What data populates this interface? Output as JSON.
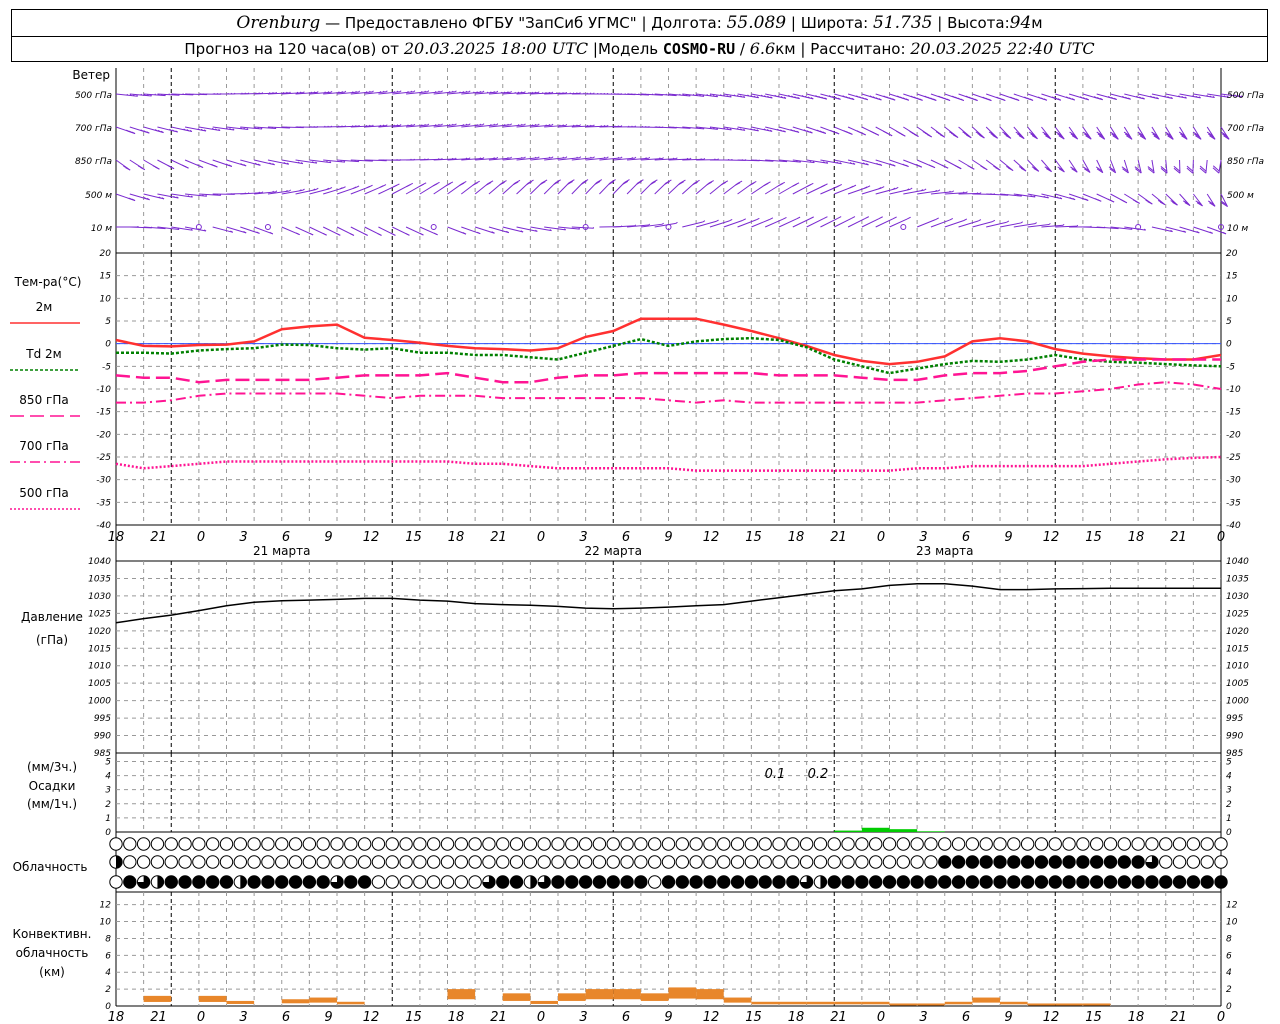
{
  "header": {
    "city": "Orenburg",
    "provider": "— Предоставлено ФГБУ \"ЗапСиб УГМС\"",
    "lon_label": "Долгота:",
    "lon": "55.089",
    "lat_label": "Широта:",
    "lat": "51.735",
    "alt_label": "Высота:",
    "alt": "94",
    "alt_unit": "м",
    "forecast_text": "Прогноз на 120 часа(ов) от",
    "forecast_start": "20.03.2025 18:00 UTC",
    "model_label": "Модель",
    "model": "COSMO-RU",
    "resolution": "6.6",
    "res_unit": "км",
    "calc_label": "Рассчитано:",
    "calc_time": "20.03.2025 22:40 UTC",
    "sep": "|"
  },
  "wind": {
    "title": "Ветер",
    "levels": [
      "500 гПа",
      "700 гПа",
      "850 гПа",
      "500 м",
      "10 м"
    ]
  },
  "temp_panel": {
    "title": "Тем-ра(°C)",
    "legend": [
      {
        "label": "2м",
        "color": "#ff3030",
        "dash": ""
      },
      {
        "label": "Td 2м",
        "color": "#008000",
        "dash": "3,2"
      },
      {
        "label": "850 гПа",
        "color": "#ff1493",
        "dash": "14,6"
      },
      {
        "label": "700 гПа",
        "color": "#ff1493",
        "dash": "10,4,2,4"
      },
      {
        "label": "500 гПа",
        "color": "#ff1493",
        "dash": "2,2"
      }
    ],
    "y_ticks": [
      "20",
      "15",
      "10",
      "5",
      "0",
      "-5",
      "-10",
      "-15",
      "-20",
      "-25",
      "-30",
      "-35",
      "-40"
    ]
  },
  "x_axis": {
    "hour_labels": [
      "18",
      "21",
      "0",
      "3",
      "6",
      "9",
      "12",
      "15",
      "18",
      "21",
      "0",
      "3",
      "6",
      "9",
      "12",
      "15",
      "18",
      "21",
      "0",
      "3",
      "6",
      "9",
      "12",
      "15",
      "18",
      "21",
      "0"
    ],
    "day_labels": [
      "21 марта",
      "22 марта",
      "23 марта"
    ]
  },
  "pressure_panel": {
    "title": "Давление",
    "unit": "(гПа)",
    "y_ticks": [
      "1040",
      "1035",
      "1030",
      "1025",
      "1020",
      "1015",
      "1010",
      "1005",
      "1000",
      "995",
      "990",
      "985"
    ]
  },
  "precip_panel": {
    "unit1": "(мм/3ч.)",
    "title": "Осадки",
    "unit2": "(мм/1ч.)",
    "y_ticks": [
      "5",
      "4",
      "3",
      "2",
      "1",
      "0"
    ],
    "annotations": [
      "0.1",
      "0.2"
    ]
  },
  "cloud_panel": {
    "title": "Облачность"
  },
  "conv_panel": {
    "title1": "Конвективн.",
    "title2": "облачность",
    "unit": "(км)",
    "y_ticks": [
      "12",
      "10",
      "8",
      "6",
      "4",
      "2",
      "0"
    ]
  },
  "chart_data": [
    {
      "type": "line",
      "title": "Тем-ра(°C)",
      "x": [
        0,
        3,
        6,
        9,
        12,
        15,
        18,
        21,
        24,
        27,
        30,
        33,
        36,
        39,
        42,
        45,
        48,
        51,
        54,
        57,
        60,
        63,
        66,
        69,
        72,
        75,
        78,
        81,
        84,
        87,
        90,
        93,
        96,
        99,
        102,
        105,
        108,
        111,
        114,
        117,
        120
      ],
      "ylim": [
        -40,
        20
      ],
      "series": [
        {
          "name": "2м",
          "color": "#ff3030",
          "values": [
            0.8,
            -0.5,
            -0.6,
            -0.3,
            -0.2,
            0.5,
            3.2,
            3.8,
            4.2,
            1.3,
            0.8,
            0.2,
            -0.5,
            -1.0,
            -1.2,
            -1.5,
            -1.0,
            1.5,
            2.8,
            5.5,
            5.5,
            5.5,
            4.2,
            2.8,
            1.2,
            -0.5,
            -2.5,
            -3.8,
            -4.5,
            -4.0,
            -2.8,
            0.5,
            1.2,
            0.5,
            -1.2,
            -2.2,
            -2.8,
            -3.2,
            -3.5,
            -3.5,
            -2.5
          ]
        },
        {
          "name": "Td 2м",
          "color": "#008000",
          "values": [
            -2.0,
            -2.0,
            -2.2,
            -1.5,
            -1.2,
            -1.0,
            -0.2,
            -0.3,
            -1.0,
            -1.3,
            -1.0,
            -2.0,
            -2.0,
            -2.5,
            -2.5,
            -3.0,
            -3.5,
            -2.0,
            -0.5,
            1.0,
            -0.5,
            0.5,
            1.0,
            1.2,
            0.8,
            -0.8,
            -3.5,
            -5.0,
            -6.5,
            -5.5,
            -4.5,
            -3.8,
            -4.0,
            -3.5,
            -2.5,
            -3.5,
            -4.0,
            -4.2,
            -4.5,
            -4.8,
            -5.0
          ]
        },
        {
          "name": "850 гПа",
          "color": "#ff1493",
          "values": [
            -7,
            -7.5,
            -7.5,
            -8.5,
            -8,
            -8,
            -8,
            -8,
            -7.5,
            -7,
            -7,
            -7,
            -6.5,
            -7.5,
            -8.5,
            -8.5,
            -7.5,
            -7,
            -7,
            -6.5,
            -6.5,
            -6.5,
            -6.5,
            -6.5,
            -7,
            -7,
            -7,
            -7.5,
            -8,
            -8,
            -7,
            -6.5,
            -6.5,
            -6,
            -5,
            -4,
            -3.5,
            -3.5,
            -3.5,
            -3.5,
            -3.5
          ]
        },
        {
          "name": "700 гПа",
          "color": "#ff1493",
          "values": [
            -13,
            -13,
            -12.5,
            -11.5,
            -11,
            -11,
            -11,
            -11,
            -11,
            -11.5,
            -12,
            -11.5,
            -11.5,
            -11.5,
            -12,
            -12,
            -12,
            -12,
            -12,
            -12,
            -12.5,
            -13,
            -12.5,
            -13,
            -13,
            -13,
            -13,
            -13,
            -13,
            -13,
            -12.5,
            -12,
            -11.5,
            -11,
            -11,
            -10.5,
            -10,
            -9,
            -8.5,
            -9,
            -10
          ]
        },
        {
          "name": "500 гПа",
          "color": "#ff1493",
          "values": [
            -26.5,
            -27.5,
            -27,
            -26.5,
            -26,
            -26,
            -26,
            -26,
            -26,
            -26,
            -26,
            -26,
            -26,
            -26.5,
            -26.5,
            -27,
            -27.5,
            -27.5,
            -27.5,
            -27.5,
            -27.5,
            -28,
            -28,
            -28,
            -28,
            -28,
            -28,
            -28,
            -28,
            -27.5,
            -27.5,
            -27,
            -27,
            -27,
            -27,
            -27,
            -26.5,
            -26,
            -25.5,
            -25.2,
            -25
          ]
        }
      ]
    },
    {
      "type": "line",
      "title": "Давление",
      "x": [
        0,
        3,
        6,
        9,
        12,
        15,
        18,
        21,
        24,
        27,
        30,
        33,
        36,
        39,
        42,
        45,
        48,
        51,
        54,
        57,
        60,
        63,
        66,
        69,
        72,
        75,
        78,
        81,
        84,
        87,
        90,
        93,
        96,
        99,
        102,
        105,
        108,
        111,
        114,
        117,
        120
      ],
      "ylim": [
        985,
        1040
      ],
      "series": [
        {
          "name": "Давление",
          "color": "#000000",
          "values": [
            1022.3,
            1023.5,
            1024.5,
            1025.8,
            1027.2,
            1028.2,
            1028.6,
            1028.8,
            1029,
            1029.3,
            1029.3,
            1028.8,
            1028.5,
            1027.8,
            1027.5,
            1027.3,
            1027,
            1026.5,
            1026.3,
            1026.5,
            1026.8,
            1027.2,
            1027.5,
            1028.5,
            1029.5,
            1030.5,
            1031.5,
            1032,
            1033,
            1033.5,
            1033.5,
            1032.8,
            1031.8,
            1031.8,
            1032,
            1032.1,
            1032.2,
            1032.2,
            1032.2,
            1032.2,
            1032.2
          ]
        }
      ]
    },
    {
      "type": "bar",
      "title": "Осадки",
      "x": [
        78,
        81,
        84,
        87
      ],
      "ylim": [
        0,
        5
      ],
      "series": [
        {
          "name": "Осадки",
          "color": "#00cc00",
          "values": [
            0.1,
            0.3,
            0.2,
            0.05
          ]
        }
      ]
    },
    {
      "type": "bar",
      "title": "Конвективн. облачность",
      "x": [
        3,
        9,
        12,
        18,
        21,
        24,
        36,
        42,
        45,
        48,
        51,
        54,
        57,
        60,
        63,
        66,
        69,
        72,
        75,
        78,
        81,
        84,
        87,
        90,
        93,
        96,
        99,
        102,
        105
      ],
      "ylim": [
        0,
        13
      ],
      "series": [
        {
          "name": "Конвективн. облачность",
          "color": "#e8862a",
          "values": [
            1.2,
            1.2,
            0.6,
            0.8,
            1.0,
            0.5,
            2.0,
            1.5,
            0.6,
            1.5,
            2.0,
            2.0,
            1.5,
            2.2,
            2.0,
            1.0,
            0.5,
            0.5,
            0.5,
            0.5,
            0.5,
            0.3,
            0.3,
            0.5,
            1.0,
            0.5,
            0.3,
            0.3,
            0.3
          ]
        }
      ]
    },
    {
      "type": "heatmap",
      "title": "Облачность",
      "levels": [
        "high",
        "mid",
        "low"
      ],
      "step_hours": 1.5,
      "cover_codes": {
        "high": "000000000000000000000000000000000000000000000000000000000000000000000000000000000",
        "mid": "200000000000000000000000000000000000000000000000000000000000444444444444444300000000000000",
        "low": "0432444442444444344000000003442344444440444444444432444444444444444444444444444444400000000"
      }
    }
  ]
}
